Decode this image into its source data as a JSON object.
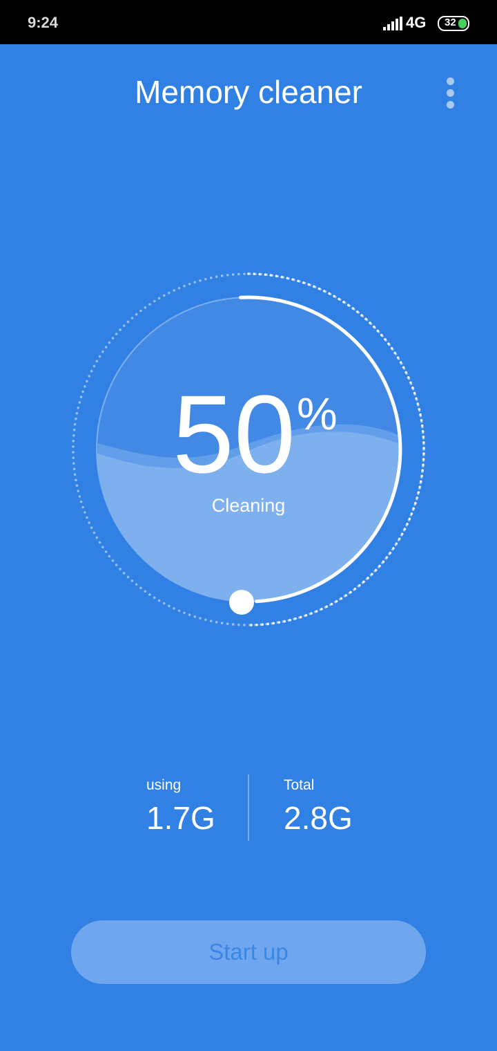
{
  "status_bar": {
    "time": "9:24",
    "network": "4G",
    "battery": "32",
    "battery_color": "#44d05b"
  },
  "header": {
    "title": "Memory cleaner",
    "menu_icon": "more-vertical-icon"
  },
  "gauge": {
    "percent": "50",
    "percent_sign": "%",
    "status": "Cleaning",
    "progress_fraction": 0.5
  },
  "stats": {
    "using_label": "using",
    "using_value": "1.7G",
    "total_label": "Total",
    "total_value": "2.8G"
  },
  "action": {
    "start_label": "Start up"
  },
  "colors": {
    "background": "#3181e4",
    "button_bg": "#70a6ed",
    "button_text": "#3a87e6"
  }
}
